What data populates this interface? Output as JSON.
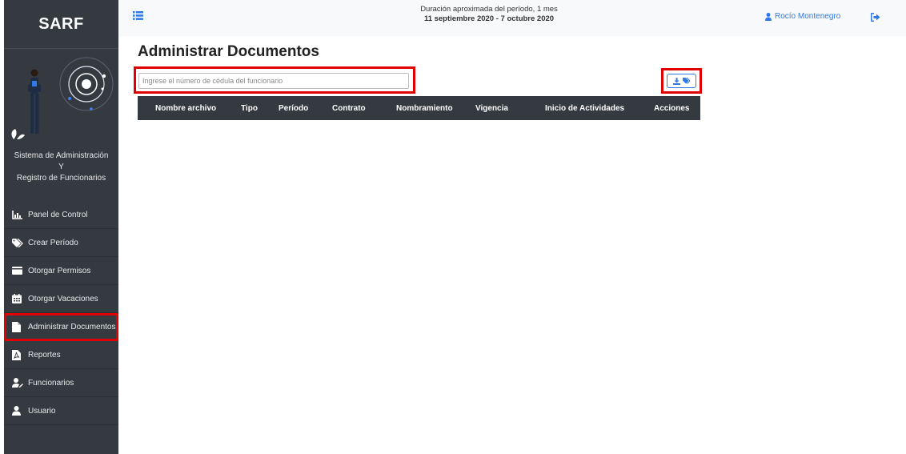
{
  "sidebar": {
    "brand": "SARF",
    "system_name": [
      "Sistema de Administración",
      "Y",
      "Registro de Funcionarios"
    ],
    "items": [
      {
        "label": "Panel de Control",
        "icon": "chart-area-icon"
      },
      {
        "label": "Crear Período",
        "icon": "tags-icon"
      },
      {
        "label": "Otorgar Permisos",
        "icon": "id-card-icon"
      },
      {
        "label": "Otorgar Vacaciones",
        "icon": "calendar-icon"
      },
      {
        "label": "Administrar Documentos",
        "icon": "file-icon",
        "active": true
      },
      {
        "label": "Reportes",
        "icon": "file-pdf-icon"
      },
      {
        "label": "Funcionarios",
        "icon": "user-edit-icon"
      },
      {
        "label": "Usuario",
        "icon": "user-icon"
      }
    ]
  },
  "topbar": {
    "period_label": "Duración aproximada del período, 1 mes",
    "period_range": "11 septiembre 2020 - 7 octubre 2020",
    "user_name": "Rocío Montenegro"
  },
  "main": {
    "title": "Administrar Documentos",
    "search_placeholder": "Ingrese el número de cédula del funcionario",
    "columns": [
      "Nombre archivo",
      "Tipo",
      "Período",
      "Contrato",
      "Nombramiento",
      "Vigencia",
      "Inicio de Actividades",
      "Acciones"
    ]
  },
  "colors": {
    "sidebar_bg": "#343a40",
    "accent": "#2f7ae5",
    "highlight": "#e00000",
    "topbar_bg": "#f8f9fa"
  }
}
